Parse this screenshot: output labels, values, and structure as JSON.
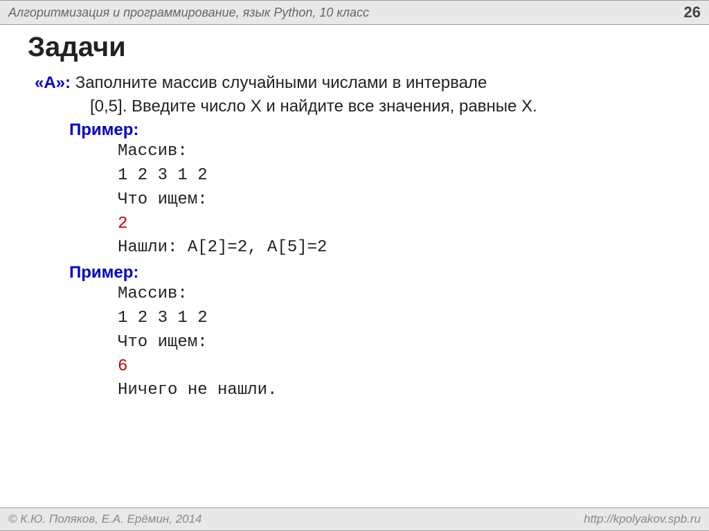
{
  "header": {
    "title": "Алгоритмизация и программирование, язык Python, 10 класс",
    "page_number": "26"
  },
  "main": {
    "title": "Задачи",
    "task_label": "«A»:",
    "task_text_line1": " Заполните массив случайными числами в интервале",
    "task_text_line2": "[0,5]. Введите число X и найдите все значения, равные X.",
    "example1": {
      "label": "Пример:",
      "lines": {
        "l1": "Массив:",
        "l2": "1 2 3 1 2",
        "l3": "Что ищем:",
        "l4": "2",
        "l5": "Нашли: A[2]=2, A[5]=2"
      }
    },
    "example2": {
      "label": "Пример:",
      "lines": {
        "l1": "Массив:",
        "l2": "1 2 3 1 2",
        "l3": "Что ищем:",
        "l4": "6",
        "l5": "Ничего не нашли."
      }
    }
  },
  "footer": {
    "copyright": "© К.Ю. Поляков, Е.А. Ерёмин, 2014",
    "url": "http://kpolyakov.spb.ru"
  }
}
